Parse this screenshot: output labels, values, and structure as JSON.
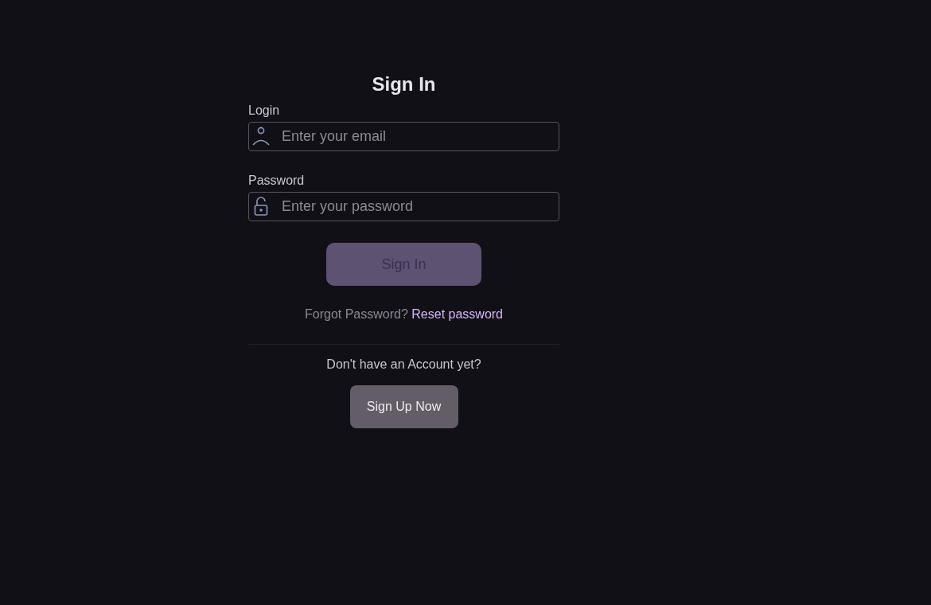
{
  "title": "Sign In",
  "fields": [
    {
      "kind": "user",
      "label": "Login",
      "placeholder": "Enter your email"
    },
    {
      "kind": "lock",
      "label": "Password",
      "placeholder": "Enter your password"
    }
  ],
  "submit": {
    "label": "Sign In",
    "disabled": true
  },
  "forgot": {
    "text": "Forgot Password?",
    "link": "Reset password"
  },
  "signup": {
    "prompt": "Don't have an Account yet?",
    "button": "Sign Up Now"
  }
}
